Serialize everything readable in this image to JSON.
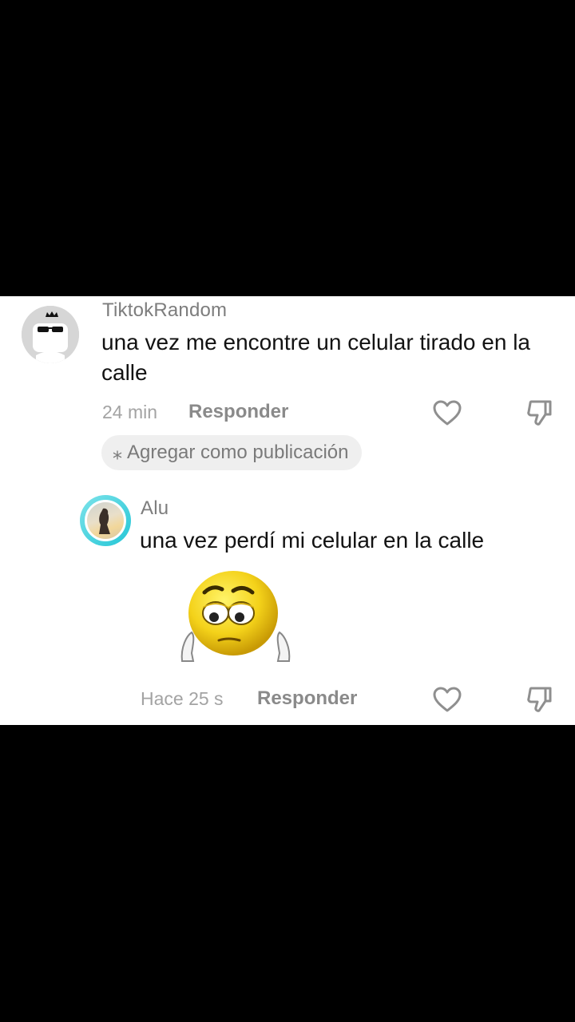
{
  "comment1": {
    "username": "TiktokRandom",
    "text": "una vez me encontre un celular tirado en la calle",
    "time": "24 min",
    "reply_label": "Responder",
    "avatar_icon": "sunglasses-face-avatar-icon",
    "add_as_post_label": "Agregar como publicación"
  },
  "comment2": {
    "username": "Alu",
    "text": "una vez perdí mi celular en la calle",
    "time": "Hace 25 s",
    "reply_label": "Responder",
    "sticker": "sad-emoji-sticker"
  },
  "colors": {
    "background": "#000000",
    "card": "#ffffff",
    "avatar_ring": "#24c6d6"
  }
}
